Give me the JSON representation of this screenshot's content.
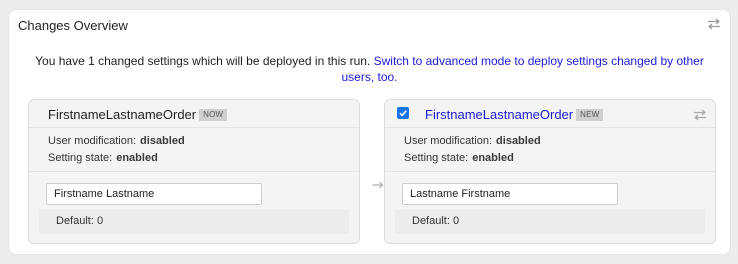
{
  "panel": {
    "title": "Changes Overview",
    "intro_text": "You have 1 changed settings which will be deployed in this run.",
    "intro_link": "Switch to advanced mode to deploy settings changed by other users, too."
  },
  "current": {
    "name": "FirstnameLastnameOrder",
    "badge": "NOW",
    "user_modification_label": "User modification:",
    "user_modification_value": "disabled",
    "setting_state_label": "Setting state:",
    "setting_state_value": "enabled",
    "value": "Firstname Lastname",
    "default_text": "Default: 0"
  },
  "changed": {
    "name": "FirstnameLastnameOrder",
    "badge": "NEW",
    "checked": true,
    "user_modification_label": "User modification:",
    "user_modification_value": "disabled",
    "setting_state_label": "Setting state:",
    "setting_state_value": "enabled",
    "value": "Lastname Firstname",
    "default_text": "Default: 0"
  },
  "colors": {
    "link": "#1a1adc",
    "checkbox": "#1a73e8",
    "card_bg": "#f4f4f4",
    "page_bg": "#ececec"
  },
  "icons": [
    "swap-arrows-icon",
    "arrow-right-icon",
    "checkmark-icon"
  ]
}
